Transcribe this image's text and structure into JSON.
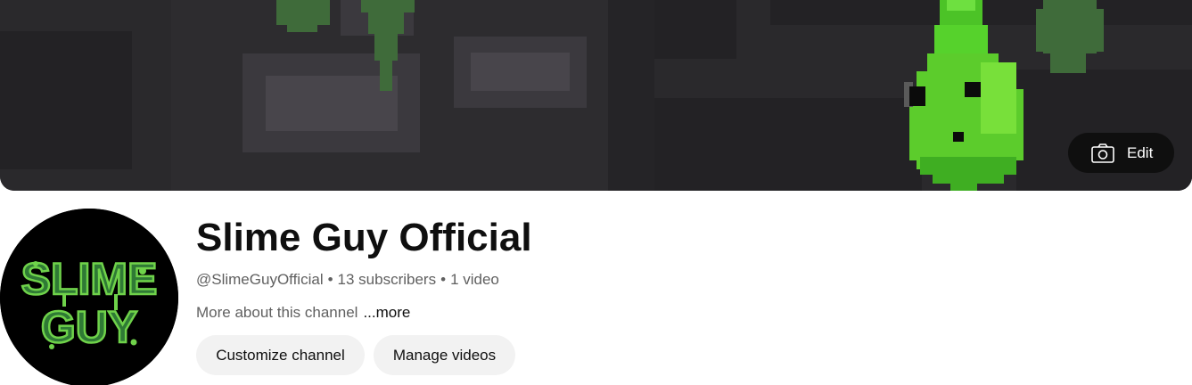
{
  "banner": {
    "edit_label": "Edit",
    "edit_icon": "camera-icon"
  },
  "channel": {
    "name": "Slime Guy Official",
    "handle": "@SlimeGuyOfficial",
    "separator": "•",
    "subscribers": "13 subscribers",
    "videos": "1 video",
    "about": "More about this channel",
    "more_link": "...more",
    "avatar_text_line1": "SLIME",
    "avatar_text_line2": "GUY"
  },
  "actions": {
    "customize_label": "Customize channel",
    "manage_label": "Manage videos"
  },
  "colors": {
    "slime_green": "#5ccc2c",
    "banner_dark": "#2a292c",
    "button_bg": "#f2f2f2"
  }
}
